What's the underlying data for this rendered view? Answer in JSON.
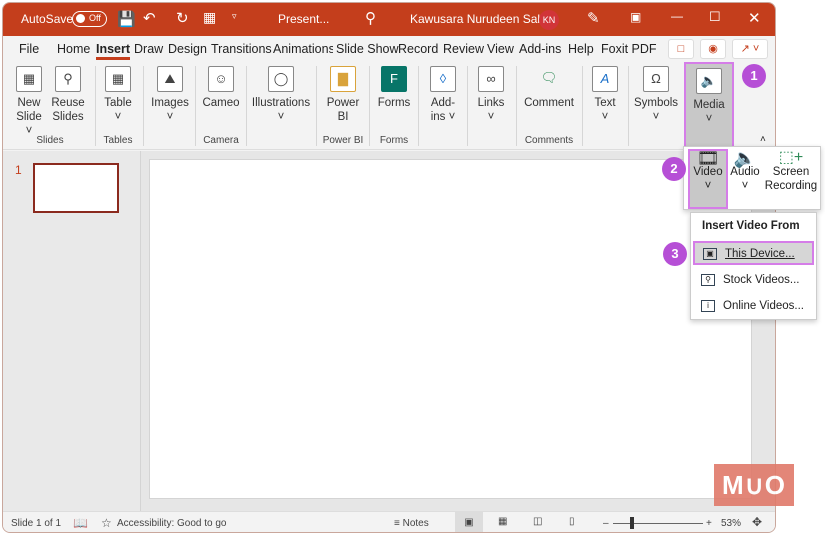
{
  "titlebar": {
    "autosave": "AutoSave",
    "autosave_state": "Off",
    "doc_title": "Present...",
    "user": "Kawusara Nurudeen Salley",
    "initials": "KN"
  },
  "tabs": [
    "File",
    "Home",
    "Insert",
    "Draw",
    "Design",
    "Transitions",
    "Animations",
    "Slide Show",
    "Record",
    "Review",
    "View",
    "Add-ins",
    "Help",
    "Foxit PDF"
  ],
  "active_tab": "Insert",
  "ribbon": {
    "buttons": [
      {
        "label": "New Slide",
        "icon": "new-slide-icon"
      },
      {
        "label": "Reuse Slides",
        "icon": "reuse-slides-icon"
      },
      {
        "label": "Table",
        "icon": "table-icon"
      },
      {
        "label": "Images",
        "icon": "image-icon"
      },
      {
        "label": "Cameo",
        "icon": "cameo-icon"
      },
      {
        "label": "Illustrations",
        "icon": "shapes-icon"
      },
      {
        "label": "Power BI",
        "icon": "power-bi-icon"
      },
      {
        "label": "Forms",
        "icon": "forms-icon"
      },
      {
        "label": "Add-ins",
        "icon": "add-ins-icon"
      },
      {
        "label": "Links",
        "icon": "link-icon"
      },
      {
        "label": "Comment",
        "icon": "comment-icon"
      },
      {
        "label": "Text",
        "icon": "text-icon"
      },
      {
        "label": "Symbols",
        "icon": "omega-icon"
      },
      {
        "label": "Media",
        "icon": "speaker-icon"
      }
    ],
    "groups": [
      "Slides",
      "Tables",
      "Camera",
      "Power BI",
      "Forms",
      "Comments"
    ]
  },
  "media_popup": {
    "video": "Video",
    "audio": "Audio",
    "screen_recording": "Screen Recording"
  },
  "video_menu": {
    "header": "Insert Video From",
    "items": [
      "This Device...",
      "Stock Videos...",
      "Online Videos..."
    ]
  },
  "steps": [
    "1",
    "2",
    "3"
  ],
  "thumbnail": {
    "number": "1"
  },
  "status": {
    "slide": "Slide 1 of 1",
    "accessibility": "Accessibility: Good to go",
    "notes": "Notes",
    "zoom": "53%",
    "zoom_value": 53
  },
  "watermark": "MUO",
  "colors": {
    "accent": "#c43e1c",
    "highlight": "#b64fd6"
  }
}
